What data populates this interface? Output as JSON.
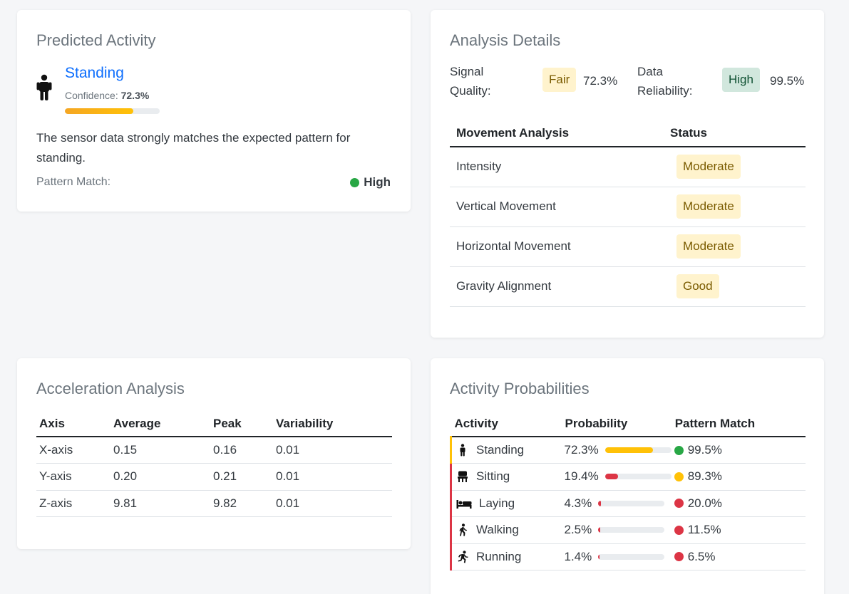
{
  "colors": {
    "primary": "#0d6efd",
    "success": "#28a745",
    "warning": "#ffc107",
    "danger": "#dc3545",
    "muted": "#6c757d"
  },
  "predicted": {
    "title": "Predicted Activity",
    "icon": "person-standing-icon",
    "activity": "Standing",
    "confidence_label": "Confidence:",
    "confidence_value": "72.3%",
    "confidence_fraction": 0.723,
    "description": "The sensor data strongly matches the expected pattern for standing.",
    "pattern_label": "Pattern Match:",
    "pattern_value": "High",
    "pattern_color": "#28a745"
  },
  "analysis": {
    "title": "Analysis Details",
    "signal_label_1": "Signal",
    "signal_label_2": "Quality:",
    "signal_badge": "Fair",
    "signal_value": "72.3%",
    "reliability_label_1": "Data",
    "reliability_label_2": "Reliability:",
    "reliability_badge": "High",
    "reliability_value": "99.5%",
    "headers": [
      "Movement Analysis",
      "Status"
    ],
    "rows": [
      {
        "label": "Intensity",
        "status": "Moderate"
      },
      {
        "label": "Vertical Movement",
        "status": "Moderate"
      },
      {
        "label": "Horizontal Movement",
        "status": "Moderate"
      },
      {
        "label": "Gravity Alignment",
        "status": "Good"
      }
    ]
  },
  "acceleration": {
    "title": "Acceleration Analysis",
    "headers": [
      "Axis",
      "Average",
      "Peak",
      "Variability"
    ],
    "rows": [
      [
        "X-axis",
        "0.15",
        "0.16",
        "0.01"
      ],
      [
        "Y-axis",
        "0.20",
        "0.21",
        "0.01"
      ],
      [
        "Z-axis",
        "9.81",
        "9.82",
        "0.01"
      ]
    ]
  },
  "probabilities": {
    "title": "Activity Probabilities",
    "headers": [
      "Activity",
      "Probability",
      "Pattern Match"
    ],
    "rows": [
      {
        "activity": "Standing",
        "icon": "person-standing-icon",
        "probability": "72.3%",
        "fraction": 0.723,
        "match": "99.5%",
        "match_color": "#28a745",
        "edge_color": "#ffc107"
      },
      {
        "activity": "Sitting",
        "icon": "chair-icon",
        "probability": "19.4%",
        "fraction": 0.194,
        "match": "89.3%",
        "match_color": "#ffc107",
        "edge_color": "#dc3545"
      },
      {
        "activity": "Laying",
        "icon": "bed-icon",
        "probability": "4.3%",
        "fraction": 0.043,
        "match": "20.0%",
        "match_color": "#dc3545",
        "edge_color": "#dc3545"
      },
      {
        "activity": "Walking",
        "icon": "person-walking-icon",
        "probability": "2.5%",
        "fraction": 0.025,
        "match": "11.5%",
        "match_color": "#dc3545",
        "edge_color": "#dc3545"
      },
      {
        "activity": "Running",
        "icon": "person-running-icon",
        "probability": "1.4%",
        "fraction": 0.014,
        "match": "6.5%",
        "match_color": "#dc3545",
        "edge_color": "#dc3545"
      }
    ]
  }
}
